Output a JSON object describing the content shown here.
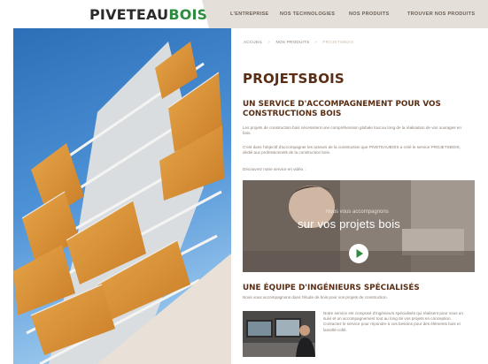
{
  "header": {
    "logo_part1": "PIVETEAU",
    "logo_part2": "BOIS",
    "nav": [
      "L'ENTREPRISE",
      "NOS TECHNOLOGIES",
      "NOS PRODUITS",
      "TROUVER NOS PRODUITS"
    ]
  },
  "breadcrumb": [
    "ACCUEIL",
    "›",
    "NOS PRODUITS",
    "›",
    "PROJETSBOIS"
  ],
  "page": {
    "title": "PROJETSBOIS",
    "section1_title": "UN SERVICE D'ACCOMPAGNEMENT POUR VOS CONSTRUCTIONS BOIS",
    "section1_p1": "Les projets de construction bois nécessitent une compréhension globale tout au long de la réalisation de vos ouvrages en bois.",
    "section1_p2": "C'est dans l'objectif d'accompagner les acteurs de la construction que PIVETEAUBOIS a créé le service PROJETSBOIS, dédié aux professionnels de la construction bois.",
    "section1_p3": "Découvrez notre service en vidéo :",
    "video_kicker": "Nous vous accompagnons",
    "video_title": "sur vos projets bois",
    "section2_title": "UNE ÉQUIPE D'INGÉNIEURS SPÉCIALISÉS",
    "section2_p1": "Nous vous accompagnons dans l'étude de bois pour vos projets de construction.",
    "section2_p2": "Notre service est composé d'ingénieurs spécialisés qui réalisent pour vous un suivi et un accompagnement tout au long de vos projets en conception. Contactez le service pour répondre à vos besoins pour des éléments bois et lamellé-collé."
  },
  "colors": {
    "brand_green": "#2e8b3f",
    "title_brown": "#5a2e14",
    "nav_bg": "#e4dfd8",
    "play_green": "#2e8b3f"
  }
}
